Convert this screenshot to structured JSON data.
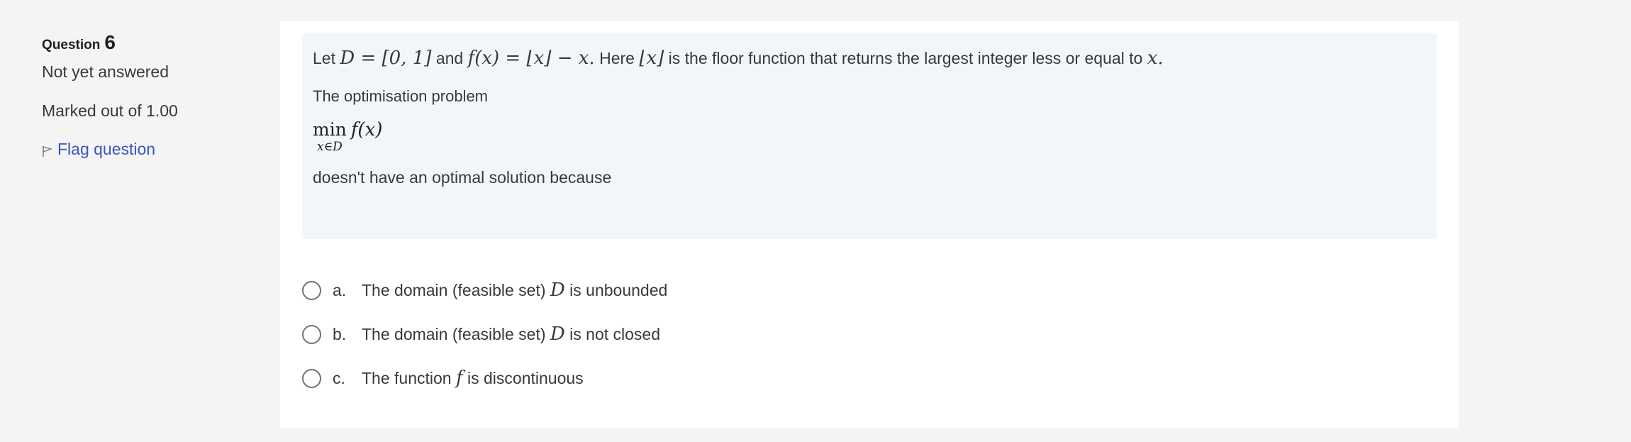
{
  "info": {
    "question_label": "Question",
    "question_number": "6",
    "state": "Not yet answered",
    "grade": "Marked out of 1.00",
    "flag_label": "Flag question",
    "flag_icon": "flag-icon"
  },
  "question": {
    "line1": {
      "let": "Let",
      "D_def": "D = [0, 1]",
      "and": "and",
      "f_def": "f(x) = ⌊x⌋ − x.",
      "here": "Here",
      "floor_x": "⌊x⌋",
      "desc": "is the floor function that returns the largest integer less or equal to",
      "x_end": "x."
    },
    "line2": "The optimisation problem",
    "min_op": "min",
    "min_sub": "x∈D",
    "min_fx": "f(x)",
    "line3": "doesn't have an optimal solution because"
  },
  "options": [
    {
      "letter": "a.",
      "pre": "The domain (feasible set)",
      "math": "D",
      "post": "is unbounded"
    },
    {
      "letter": "b.",
      "pre": "The domain (feasible set)",
      "math": "D",
      "post": "is not closed"
    },
    {
      "letter": "c.",
      "pre": "The function",
      "math": "f",
      "post": "is discontinuous"
    }
  ]
}
